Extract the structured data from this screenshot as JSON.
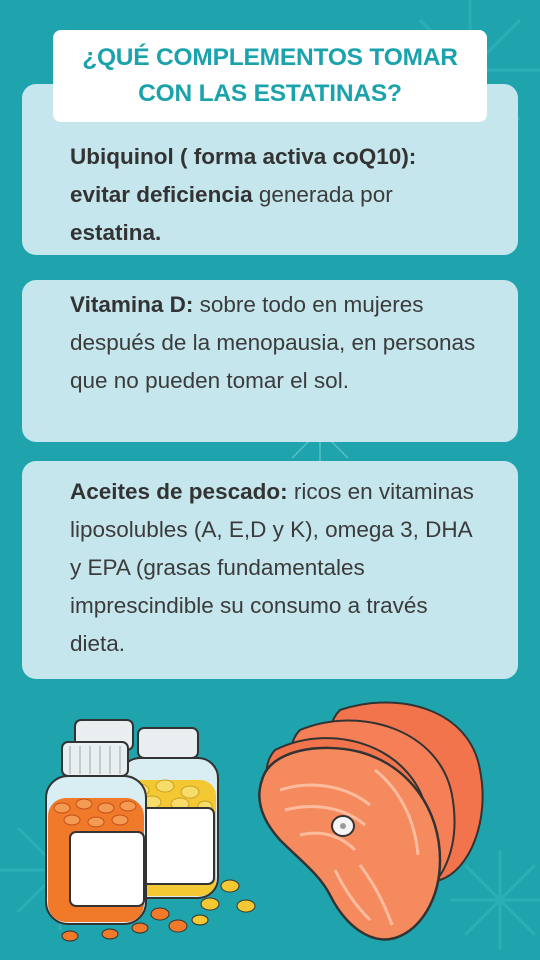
{
  "title": "¿QUÉ COMPLEMENTOS TOMAR\nCON LAS ESTATINAS?",
  "cards": [
    {
      "bold1": "Ubiquinol ( forma activa coQ10):",
      "bold2": "evitar deficiencia",
      "text1": " generada por ",
      "bold3": "estatina."
    },
    {
      "bold1": "Vitamina D:",
      "text1": " sobre todo en mujeres después de la menopausia, en personas que no pueden tomar el sol."
    },
    {
      "bold1": "Aceites de pescado:",
      "text1": " ricos en vitaminas liposolubles (A, E,D y K), omega 3, DHA y EPA (grasas fundamentales imprescindible su consumo a través dieta."
    }
  ],
  "colors": {
    "background": "#1fa4ad",
    "title_text": "#1aa3ad",
    "card": "#c5e6ec",
    "body_text": "#3b3b3b",
    "pill_orange": "#f07a2a",
    "pill_yellow": "#f3c832",
    "salmon": "#f2744c"
  },
  "icons": [
    "pill-bottle-icon",
    "salmon-steak-icon"
  ]
}
